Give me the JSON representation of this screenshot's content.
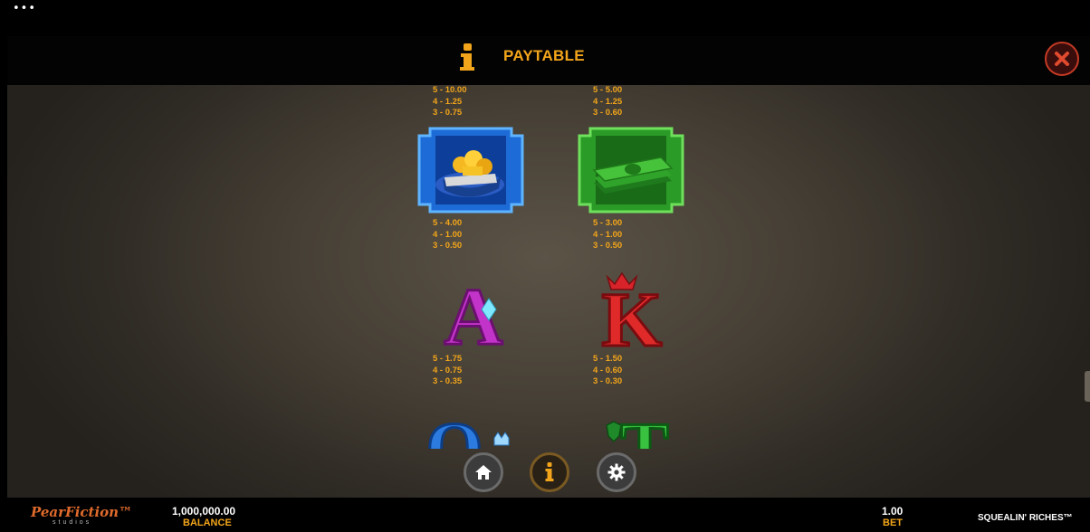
{
  "topbar": {
    "menu_dots": "•••"
  },
  "header": {
    "title": "PAYTABLE",
    "close_icon": "close-icon",
    "info_icon": "info-icon",
    "accent": "#f2a51a"
  },
  "paytable": {
    "top_left": [
      "5 - 10.00",
      "4 - 1.25",
      "3 - 0.75"
    ],
    "top_right": [
      "5 - 5.00",
      "4 - 1.25",
      "3 - 0.60"
    ],
    "symbols": [
      {
        "name": "gold-bag-symbol",
        "pays": [
          "5 - 4.00",
          "4 - 1.00",
          "3 - 0.50"
        ]
      },
      {
        "name": "cash-stack-symbol",
        "pays": [
          "5 - 3.00",
          "4 - 1.00",
          "3 - 0.50"
        ]
      },
      {
        "name": "ace-symbol",
        "letter": "A",
        "pays": [
          "5 - 1.75",
          "4 - 0.75",
          "3 - 0.35"
        ]
      },
      {
        "name": "king-symbol",
        "letter": "K",
        "pays": [
          "5 - 1.50",
          "4 - 0.60",
          "3 - 0.30"
        ]
      },
      {
        "name": "queen-symbol",
        "letter": "Q"
      },
      {
        "name": "ten-symbol",
        "letter": "T"
      }
    ]
  },
  "nav": {
    "home_icon": "home-icon",
    "info_icon": "info-icon",
    "settings_icon": "gear-icon"
  },
  "footer": {
    "logo": "PearFiction™",
    "logo_sub": "studios",
    "balance_value": "1,000,000.00",
    "balance_label": "BALANCE",
    "bet_value": "1.00",
    "bet_label": "BET",
    "game_name": "SQUEALIN' RICHES™"
  }
}
